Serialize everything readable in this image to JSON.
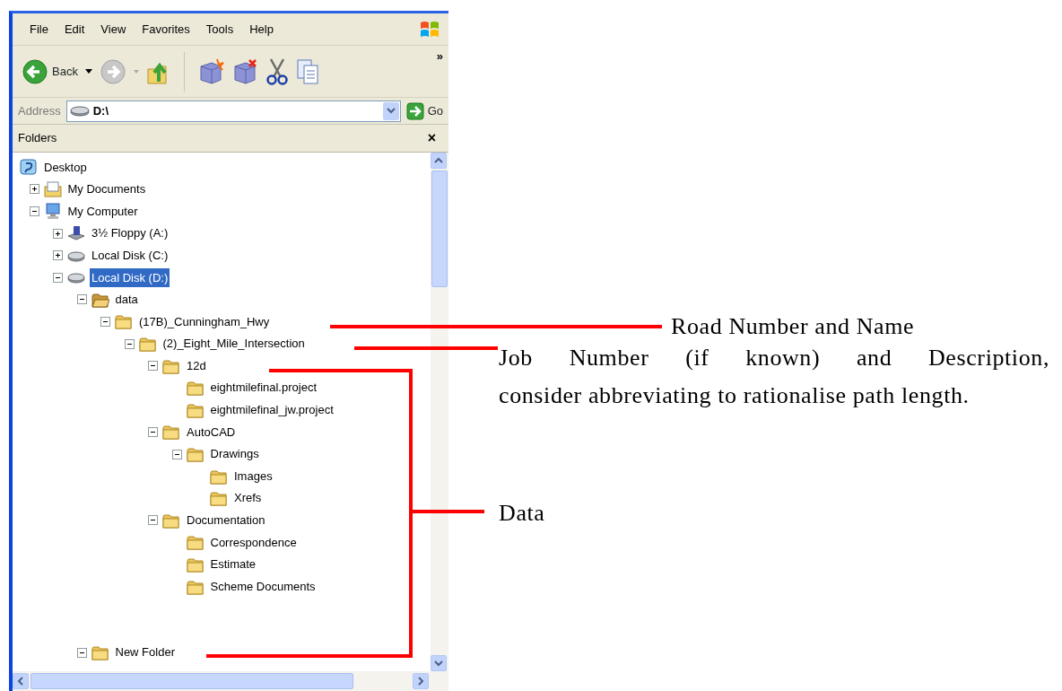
{
  "menu": [
    "File",
    "Edit",
    "View",
    "Favorites",
    "Tools",
    "Help"
  ],
  "toolbar": {
    "back_label": "Back",
    "chevron": "»"
  },
  "address": {
    "label": "Address",
    "value": "D:\\",
    "go_label": "Go"
  },
  "folders_pane": {
    "title": "Folders",
    "close": "×"
  },
  "tree": [
    {
      "label": "Desktop",
      "kind": "desktop",
      "selected": false,
      "children": [
        {
          "label": "My Documents",
          "kind": "documents",
          "expanded": false,
          "selected": false
        },
        {
          "label": "My Computer",
          "kind": "computer",
          "expanded": true,
          "selected": false,
          "children": [
            {
              "label": "3½ Floppy (A:)",
              "kind": "floppy",
              "expanded": false,
              "selected": false
            },
            {
              "label": "Local Disk (C:)",
              "kind": "drive",
              "expanded": false,
              "selected": false
            },
            {
              "label": "Local Disk (D:)",
              "kind": "drive",
              "expanded": true,
              "selected": true,
              "children": [
                {
                  "label": "data",
                  "kind": "open-folder",
                  "expanded": true,
                  "selected": false,
                  "children": [
                    {
                      "label": "(17B)_Cunningham_Hwy",
                      "kind": "folder",
                      "expanded": true,
                      "selected": false,
                      "children": [
                        {
                          "label": "(2)_Eight_Mile_Intersection",
                          "kind": "folder",
                          "expanded": true,
                          "selected": false,
                          "children": [
                            {
                              "label": "12d",
                              "kind": "folder",
                              "expanded": true,
                              "selected": false,
                              "children": [
                                {
                                  "label": "eightmilefinal.project",
                                  "kind": "folder",
                                  "selected": false
                                },
                                {
                                  "label": "eightmilefinal_jw.project",
                                  "kind": "folder",
                                  "selected": false
                                }
                              ]
                            },
                            {
                              "label": "AutoCAD",
                              "kind": "folder",
                              "expanded": true,
                              "selected": false,
                              "children": [
                                {
                                  "label": "Drawings",
                                  "kind": "folder",
                                  "expanded": true,
                                  "selected": false,
                                  "children": [
                                    {
                                      "label": "Images",
                                      "kind": "folder",
                                      "selected": false
                                    },
                                    {
                                      "label": "Xrefs",
                                      "kind": "folder",
                                      "selected": false
                                    }
                                  ]
                                }
                              ]
                            },
                            {
                              "label": "Documentation",
                              "kind": "folder",
                              "expanded": true,
                              "selected": false,
                              "children": [
                                {
                                  "label": "Correspondence",
                                  "kind": "folder",
                                  "selected": false
                                },
                                {
                                  "label": "Estimate",
                                  "kind": "folder",
                                  "selected": false
                                },
                                {
                                  "label": "Scheme Documents",
                                  "kind": "folder",
                                  "selected": false
                                }
                              ]
                            }
                          ]
                        }
                      ]
                    }
                  ]
                },
                {
                  "label": "New Folder",
                  "kind": "folder",
                  "expanded": true,
                  "selected": false
                }
              ]
            }
          ]
        }
      ]
    }
  ],
  "annotations": [
    {
      "lines": [
        "Road Number and Name"
      ]
    },
    {
      "lines": [
        "Job Number (if known) and Description,",
        "consider abbreviating to rationalise path length."
      ]
    },
    {
      "lines": [
        "Data"
      ]
    }
  ]
}
